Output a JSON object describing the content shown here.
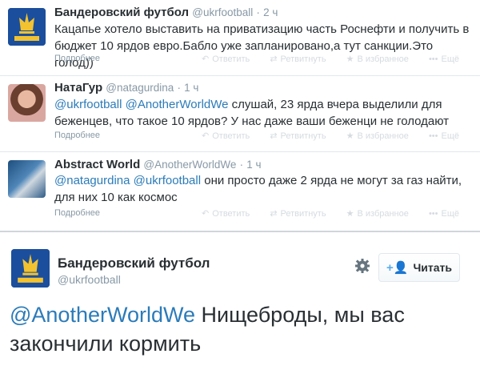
{
  "tweets": [
    {
      "fullname": "Бандеровский футбол",
      "screen_name": "@ukrfootball",
      "time": "2 ч",
      "mentions": "",
      "text": "Кацапье хотело выставить на приватизацию часть Роснефти и получить в бюджет 10 ярдов евро.Бабло уже запланировано,а тут санкции.Это голод))",
      "avatar": "ukraine-football-logo"
    },
    {
      "fullname": "НатаГур",
      "screen_name": "@natagurdina",
      "time": "1 ч",
      "mentions": "@ukrfootball @AnotherWorldWe",
      "text": " слушай, 23 ярда вчера выделили для беженцев, что такое 10 ярдов? У нас даже ваши беженци не голодают",
      "avatar": "user-photo"
    },
    {
      "fullname": "Abstract World",
      "screen_name": "@AnotherWorldWe",
      "time": "1 ч",
      "mentions": "@natagurdina @ukrfootball",
      "text": " они просто даже 2 ярда не могут за газ найти, для них 10 как космос",
      "avatar": "astronaut-photo"
    }
  ],
  "footer": {
    "details": "Подробнее",
    "reply": "Ответить",
    "retweet": "Ретвитнуть",
    "favorite": "В избранное",
    "more": "Ещё"
  },
  "featured": {
    "fullname": "Бандеровский футбол",
    "screen_name": "@ukrfootball",
    "follow_label": "Читать",
    "mention": "@AnotherWorldWe",
    "text": " Нищеброды, мы вас закончили кормить"
  },
  "colors": {
    "link": "#2b7bb9",
    "muted": "#8899a6",
    "logo_bg": "#1b4e9c",
    "logo_gold": "#f2c230"
  }
}
